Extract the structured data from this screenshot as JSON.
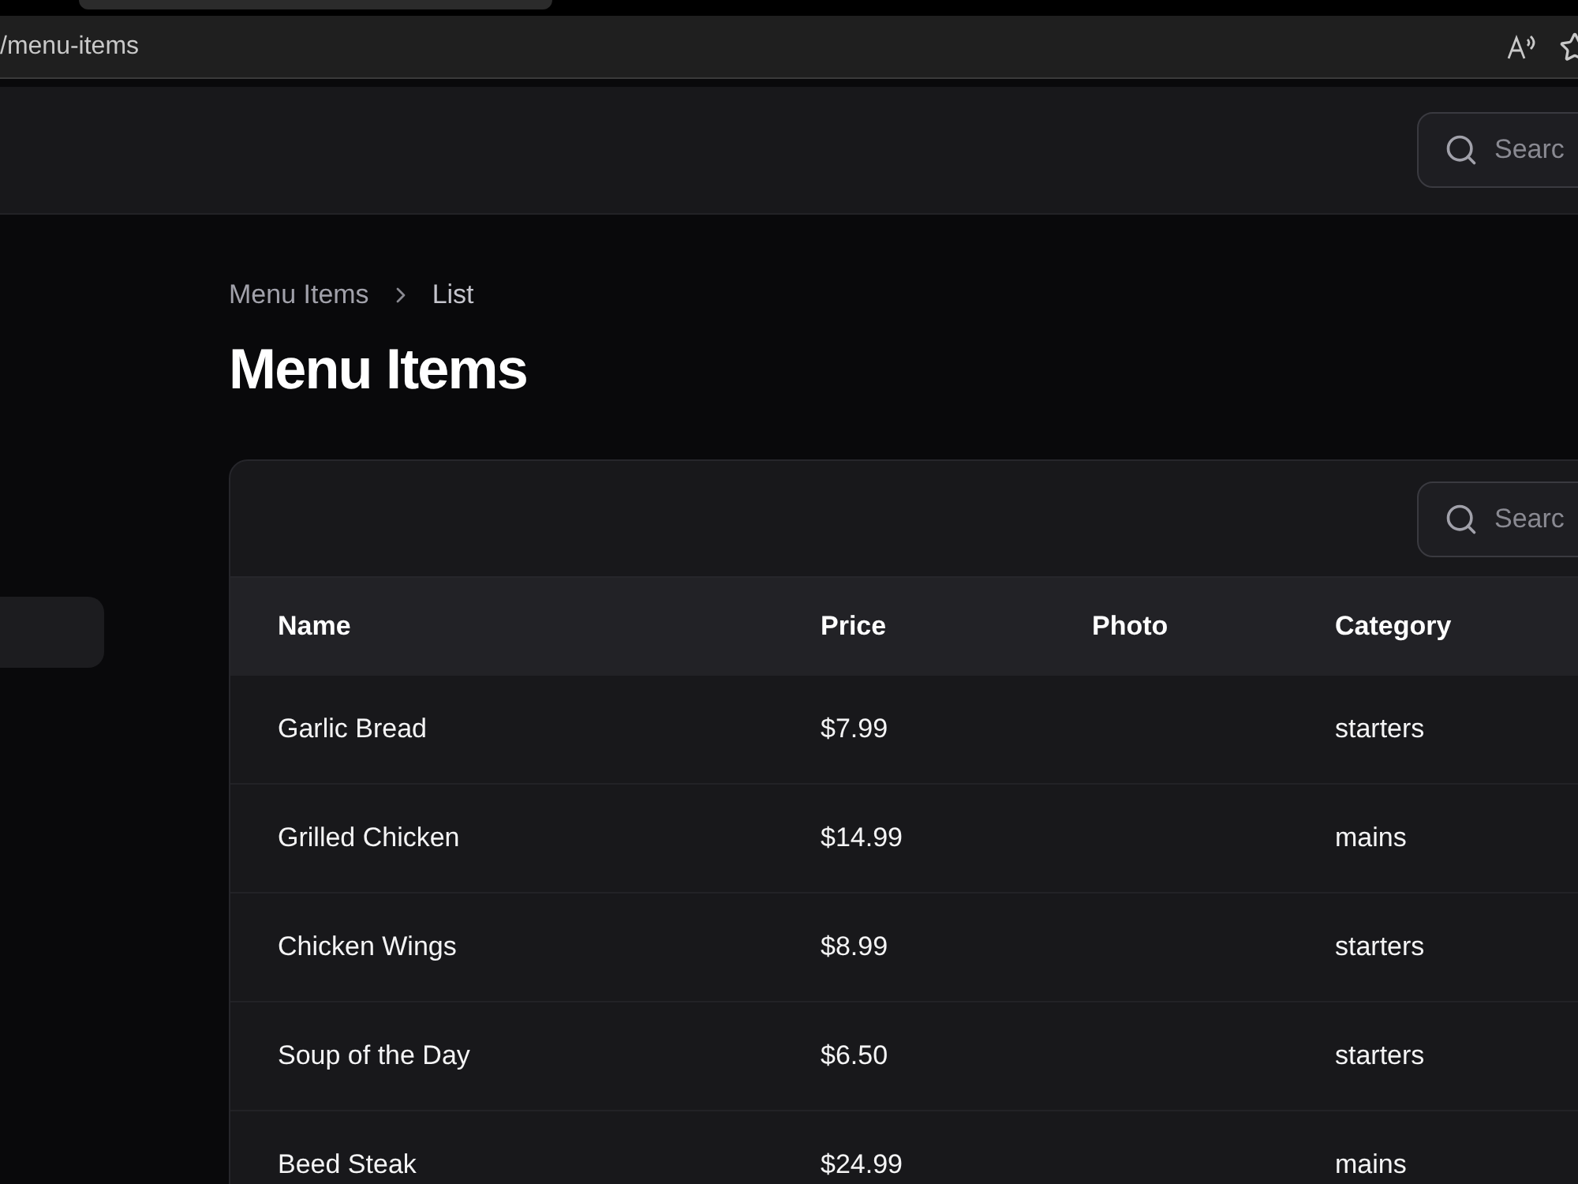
{
  "browser": {
    "address": "/menu-items"
  },
  "topbar": {
    "search": {
      "placeholder": "Searc"
    }
  },
  "sidebar": {
    "items": [
      {
        "selected": true
      }
    ]
  },
  "breadcrumb": [
    "Menu Items",
    "List"
  ],
  "title": "Menu Items",
  "table": {
    "search": {
      "placeholder": "Searc"
    },
    "columns": [
      "Name",
      "Price",
      "Photo",
      "Category"
    ],
    "rows": [
      [
        "Garlic Bread",
        "$7.99",
        "",
        "starters"
      ],
      [
        "Grilled Chicken",
        "$14.99",
        "",
        "mains"
      ],
      [
        "Chicken Wings",
        "$8.99",
        "",
        "starters"
      ],
      [
        "Soup of the Day",
        "$6.50",
        "",
        "starters"
      ],
      [
        "Beed Steak",
        "$24.99",
        "",
        "mains"
      ]
    ]
  }
}
